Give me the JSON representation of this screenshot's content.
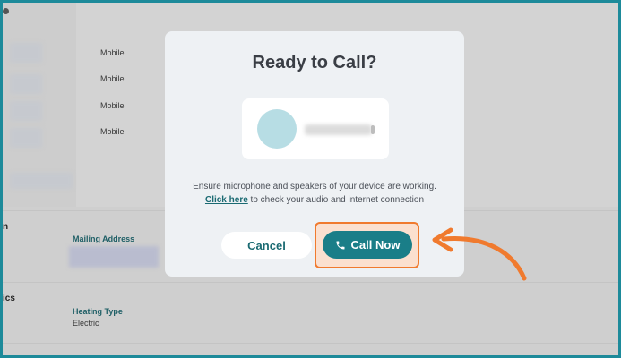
{
  "background": {
    "phone_labels": [
      "Mobile",
      "Mobile",
      "Mobile",
      "Mobile"
    ],
    "section_fragment_1": "n",
    "mailing_address_label": "Mailing Address",
    "section_fragment_2": "ics",
    "heating_type_label": "Heating Type",
    "heating_type_value": "Electric"
  },
  "modal": {
    "title": "Ready to Call?",
    "hint_line1": "Ensure microphone and speakers of your device are working.",
    "hint_link": "Click here",
    "hint_line2_rest": " to check your audio and internet connection",
    "cancel_label": "Cancel",
    "call_label": "Call Now",
    "call_icon": "phone-icon"
  },
  "colors": {
    "accent": "#1a7e88",
    "highlight": "#f07a2e",
    "frame": "#1d8a9a"
  }
}
